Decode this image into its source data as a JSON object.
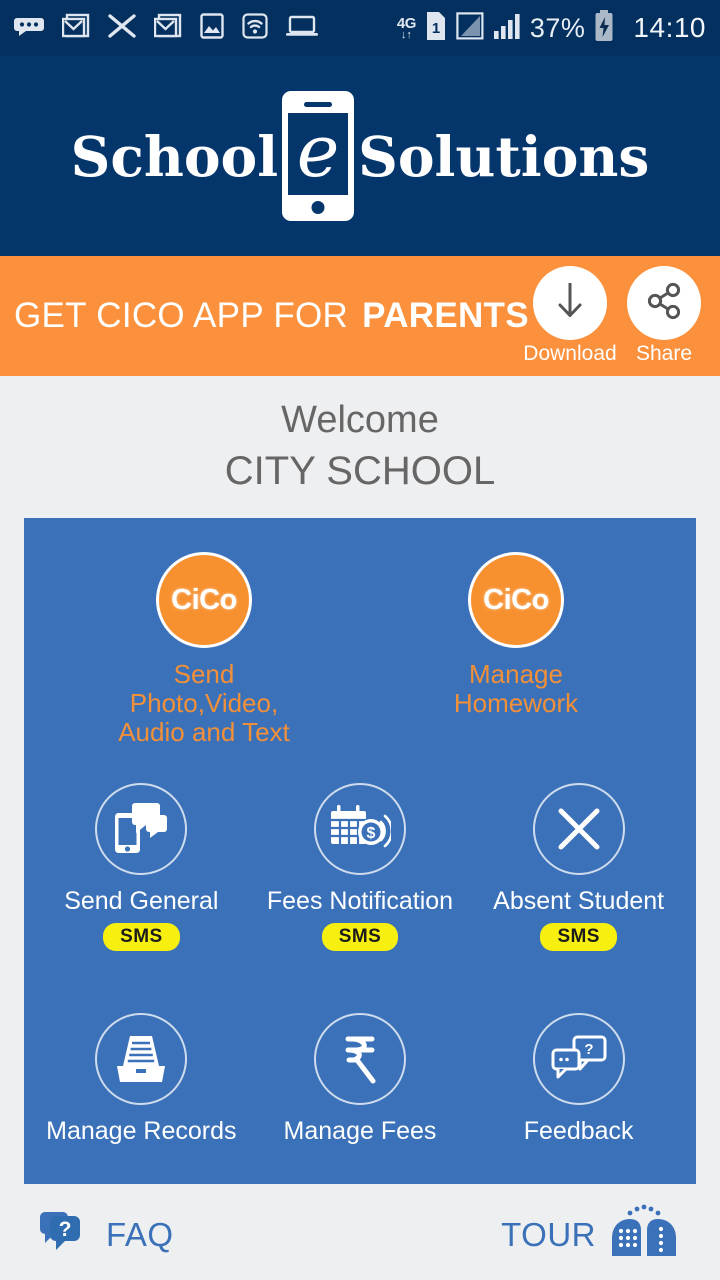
{
  "statusbar": {
    "icons": [
      "more-dots-icon",
      "gmail-icon",
      "mail-icon",
      "gmail-icon",
      "photo-icon",
      "wifi-icon",
      "laptop-icon"
    ],
    "network_type": "4G",
    "network_arrows": "↓↑",
    "sim": "1",
    "battery_percent": "37%",
    "clock": "14:10"
  },
  "logo": {
    "left_word": "School",
    "phone_letter": "e",
    "right_word": "Solutions",
    "background_color": "#04356b"
  },
  "banner": {
    "text_light": "GET CICO APP FOR",
    "text_bold": "PARENTS",
    "background_color": "#fb913c",
    "actions": [
      {
        "label": "Download",
        "icon": "download-arrow-icon"
      },
      {
        "label": "Share",
        "icon": "share-nodes-icon"
      }
    ]
  },
  "welcome": {
    "greeting": "Welcome",
    "school_name": "CITY SCHOOL"
  },
  "card": {
    "background_color": "#3a71b8",
    "cico_rows": [
      {
        "badge_text": "CiCo",
        "label": "Send Photo,Video,\nAudio and Text",
        "label_line1": "Send Photo,Video,",
        "label_line2": "Audio and Text",
        "color": "#f2903a"
      },
      {
        "badge_text": "CiCo",
        "label": "Manage Homework",
        "label_line1": "Manage",
        "label_line2": "Homework",
        "color": "#f2903a"
      }
    ],
    "row2": [
      {
        "icon": "phone-chat-icon",
        "label": "Send General",
        "badge": "SMS"
      },
      {
        "icon": "calendar-money-icon",
        "label": "Fees Notification",
        "badge": "SMS"
      },
      {
        "icon": "cross-x-icon",
        "label": "Absent Student",
        "badge": "SMS"
      }
    ],
    "row3": [
      {
        "icon": "file-tray-icon",
        "label": "Manage Records"
      },
      {
        "icon": "rupee-icon",
        "label": "Manage Fees"
      },
      {
        "icon": "chat-question-icon",
        "label": "Feedback"
      }
    ]
  },
  "bottombar": {
    "faq_label": "FAQ",
    "faq_icon": "chat-question-icon",
    "tour_label": "TOUR",
    "tour_icon": "two-heads-icon",
    "accent_color": "#3a71b8"
  }
}
